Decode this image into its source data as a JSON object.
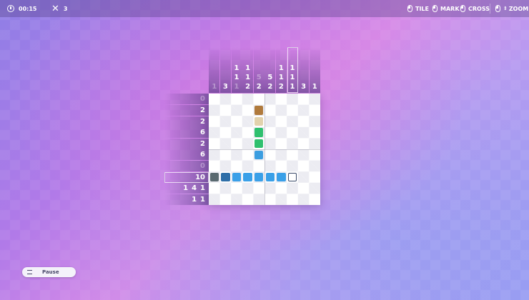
{
  "topbar": {
    "timer": "00:15",
    "mistakes": "3",
    "controls": [
      {
        "icon": "mouse-left-icon",
        "label": "TILE"
      },
      {
        "icon": "mouse-right-icon",
        "label": "MARK"
      },
      {
        "icon": "mouse-middle-icon",
        "label": "CROSS"
      },
      {
        "icon": "mouse-scroll-icon",
        "label": "ZOOM"
      }
    ]
  },
  "puzzle": {
    "size": 10,
    "column_clues": [
      {
        "values": [
          "1"
        ],
        "done": true
      },
      {
        "values": [
          "3"
        ],
        "done": false
      },
      {
        "values": [
          "1",
          "1",
          "1"
        ],
        "done": false
      },
      {
        "values": [
          "1",
          "1",
          "2"
        ],
        "done": false
      },
      {
        "values": [
          "5",
          "2"
        ],
        "done": false
      },
      {
        "values": [
          "5",
          "2"
        ],
        "done": false
      },
      {
        "values": [
          "1",
          "1",
          "2"
        ],
        "done": false
      },
      {
        "values": [
          "1",
          "1",
          "1"
        ],
        "done": false
      },
      {
        "values": [
          "3"
        ],
        "done": false
      },
      {
        "values": [
          "1"
        ],
        "done": false
      }
    ],
    "column_clue_done_flags": [
      [
        true
      ],
      [
        false
      ],
      [
        false,
        false,
        true
      ],
      [
        false,
        false,
        false
      ],
      [
        true,
        false
      ],
      [
        false,
        false
      ],
      [
        false,
        false,
        false
      ],
      [
        false,
        false,
        false
      ],
      [
        false
      ],
      [
        false
      ]
    ],
    "row_clues": [
      {
        "values": "0",
        "done": true
      },
      {
        "values": "2",
        "done": false
      },
      {
        "values": "2",
        "done": false
      },
      {
        "values": "6",
        "done": false
      },
      {
        "values": "2",
        "done": false
      },
      {
        "values": "6",
        "done": false
      },
      {
        "values": "0",
        "done": true
      },
      {
        "values": "10",
        "done": false
      },
      {
        "values": "1 4 1",
        "done": false
      },
      {
        "values": "1 1",
        "done": false
      }
    ],
    "highlight": {
      "row": 7,
      "col": 7
    },
    "filled_tiles": [
      {
        "row": 1,
        "col": 4,
        "color": "#b07a3c"
      },
      {
        "row": 2,
        "col": 4,
        "color": "#e2d2ad"
      },
      {
        "row": 3,
        "col": 4,
        "color": "#2fc06e"
      },
      {
        "row": 4,
        "col": 4,
        "color": "#2fc06e"
      },
      {
        "row": 5,
        "col": 4,
        "color": "#3c9ee0"
      },
      {
        "row": 7,
        "col": 0,
        "color": "#5a6a70"
      },
      {
        "row": 7,
        "col": 1,
        "color": "#2f6fa8"
      },
      {
        "row": 7,
        "col": 2,
        "color": "#3aa0e8"
      },
      {
        "row": 7,
        "col": 3,
        "color": "#3aa0e8"
      },
      {
        "row": 7,
        "col": 4,
        "color": "#3aa0e8"
      },
      {
        "row": 7,
        "col": 5,
        "color": "#3aa0e8"
      },
      {
        "row": 7,
        "col": 6,
        "color": "#3aa0e8"
      }
    ],
    "cursor": {
      "row": 7,
      "col": 7
    }
  },
  "pause": {
    "label": "Pause",
    "icon": "menu-icon"
  }
}
